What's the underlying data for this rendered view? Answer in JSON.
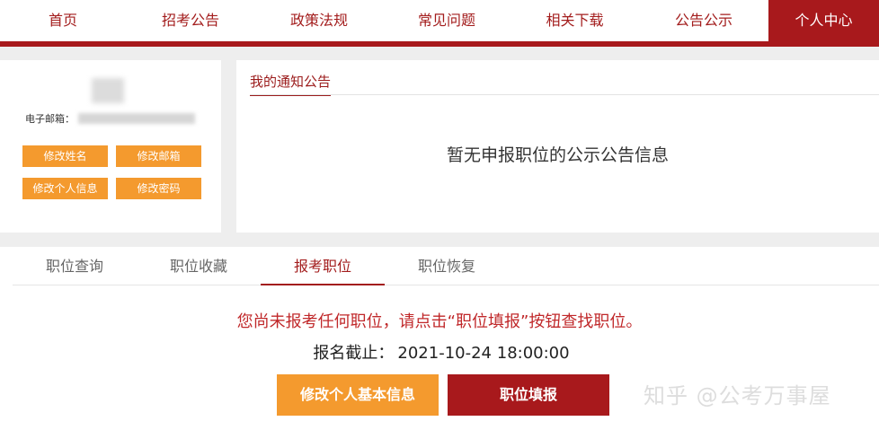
{
  "nav": {
    "items": [
      "首页",
      "招考公告",
      "政策法规",
      "常见问题",
      "相关下载",
      "公告公示",
      "个人中心"
    ],
    "active": "个人中心"
  },
  "profile": {
    "email_label": "电子邮箱：",
    "buttons": [
      "修改姓名",
      "修改邮箱",
      "修改个人信息",
      "修改密码"
    ]
  },
  "notice": {
    "tab_label": "我的通知公告",
    "empty_text": "暂无申报职位的公示公告信息"
  },
  "position": {
    "tabs": [
      "职位查询",
      "职位收藏",
      "报考职位",
      "职位恢复"
    ],
    "active_tab": "报考职位",
    "warning": "您尚未报考任何职位，请点击“职位填报”按钮查找职位。",
    "deadline_label": "报名截止：",
    "deadline_value": "2021-10-24 18:00:00",
    "edit_button": "修改个人基本信息",
    "apply_button": "职位填报"
  },
  "watermark": "知乎 @公考万事屋",
  "colors": {
    "brand_red": "#a8191c",
    "accent_orange": "#f49a2e",
    "warning_red": "#c0282a"
  }
}
